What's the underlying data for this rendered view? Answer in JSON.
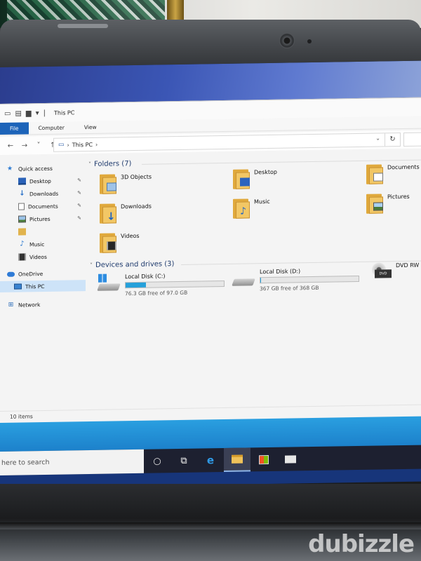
{
  "window": {
    "title": "This PC",
    "ribbon_tabs": [
      "File",
      "Computer",
      "View"
    ]
  },
  "address": {
    "path": "This PC"
  },
  "sidebar": {
    "items": [
      {
        "label": "Quick access",
        "icon": "star-icon"
      },
      {
        "label": "Desktop",
        "icon": "desktop-icon",
        "pinned": true
      },
      {
        "label": "Downloads",
        "icon": "download-icon",
        "pinned": true
      },
      {
        "label": "Documents",
        "icon": "document-icon",
        "pinned": true
      },
      {
        "label": "Pictures",
        "icon": "pictures-icon",
        "pinned": true
      },
      {
        "label": "",
        "icon": "folder-icon"
      },
      {
        "label": "Music",
        "icon": "music-icon"
      },
      {
        "label": "Videos",
        "icon": "video-icon"
      },
      {
        "label": "OneDrive",
        "icon": "onedrive-icon"
      },
      {
        "label": "This PC",
        "icon": "computer-icon",
        "selected": true
      },
      {
        "label": "Network",
        "icon": "network-icon"
      }
    ]
  },
  "folders": {
    "header": "Folders (7)",
    "items": [
      {
        "label": "3D Objects",
        "icon": "3d-objects-folder-icon"
      },
      {
        "label": "Desktop",
        "icon": "desktop-folder-icon"
      },
      {
        "label": "Documents",
        "icon": "documents-folder-icon"
      },
      {
        "label": "Downloads",
        "icon": "downloads-folder-icon"
      },
      {
        "label": "Music",
        "icon": "music-folder-icon"
      },
      {
        "label": "Pictures",
        "icon": "pictures-folder-icon"
      },
      {
        "label": "Videos",
        "icon": "videos-folder-icon"
      }
    ]
  },
  "drives": {
    "header": "Devices and drives (3)",
    "items": [
      {
        "label": "Local Disk (C:)",
        "free_text": "76.3 GB free of 97.0 GB",
        "used_fraction": 0.21,
        "bar_color": "#26a0da"
      },
      {
        "label": "Local Disk (D:)",
        "free_text": "367 GB free of 368 GB",
        "used_fraction": 0.01,
        "bar_color": "#26a0da"
      },
      {
        "label": "DVD RW",
        "icon_text": "DVD"
      }
    ]
  },
  "status": {
    "items_text": "10 items"
  },
  "taskbar": {
    "search_placeholder": "here to search"
  },
  "watermark": "dubizzle"
}
